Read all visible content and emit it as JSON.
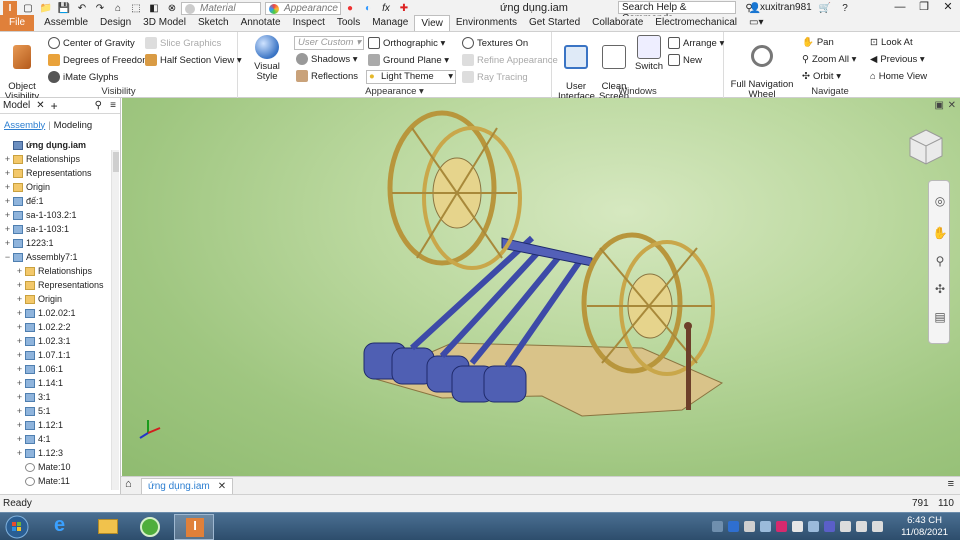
{
  "titlebar": {
    "app_letter": "I",
    "material": "Material",
    "appearance": "Appearance",
    "doc_title": "ứng dụng.iam",
    "search": "Search Help & Commands...",
    "user": "xuxitran981"
  },
  "tabs": [
    "File",
    "Assemble",
    "Design",
    "3D Model",
    "Sketch",
    "Annotate",
    "Inspect",
    "Tools",
    "Manage",
    "View",
    "Environments",
    "Get Started",
    "Collaborate",
    "Electromechanical"
  ],
  "ribbon": {
    "visibility": {
      "object_visibility": "Object\nVisibility",
      "center_of_gravity": "Center of Gravity",
      "degrees_of_freedom": "Degrees of Freedom",
      "imate_glyphs": "iMate Glyphs",
      "slice_graphics": "Slice Graphics",
      "half_section_view": "Half Section View",
      "label": "Visibility"
    },
    "appearance": {
      "visual_style": "Visual Style",
      "user_custom": "User Custom",
      "shadows": "Shadows",
      "reflections": "Reflections",
      "orthographic": "Orthographic",
      "ground_plane": "Ground Plane",
      "light_theme": "Light Theme",
      "textures_on": "Textures On",
      "refine_appearance": "Refine Appearance",
      "ray_tracing": "Ray Tracing",
      "label": "Appearance"
    },
    "windows": {
      "user_interface": "User\nInterface",
      "clean_screen": "Clean\nScreen",
      "switch": "Switch",
      "arrange": "Arrange",
      "new": "New",
      "label": "Windows"
    },
    "navigate": {
      "full_navigation_wheel": "Full Navigation\nWheel",
      "pan": "Pan",
      "zoom_all": "Zoom All",
      "orbit": "Orbit",
      "look_at": "Look At",
      "previous": "Previous",
      "home_view": "Home View",
      "label": "Navigate"
    }
  },
  "browser": {
    "title": "Model",
    "subtab_assembly": "Assembly",
    "subtab_modeling": "Modeling",
    "tree": [
      {
        "label": "ứng dụng.iam",
        "icon": "root",
        "exp": "",
        "indent": 0,
        "bold": true
      },
      {
        "label": "Relationships",
        "icon": "folder",
        "exp": "+",
        "indent": 0
      },
      {
        "label": "Representations",
        "icon": "folder",
        "exp": "+",
        "indent": 0
      },
      {
        "label": "Origin",
        "icon": "folder",
        "exp": "+",
        "indent": 0
      },
      {
        "label": "đế:1",
        "icon": "part",
        "exp": "+",
        "indent": 0
      },
      {
        "label": "sa-1-103.2:1",
        "icon": "part",
        "exp": "+",
        "indent": 0
      },
      {
        "label": "sa-1-103:1",
        "icon": "part",
        "exp": "+",
        "indent": 0
      },
      {
        "label": "1223:1",
        "icon": "part",
        "exp": "+",
        "indent": 0
      },
      {
        "label": "Assembly7:1",
        "icon": "part",
        "exp": "−",
        "indent": 0
      },
      {
        "label": "Relationships",
        "icon": "folder",
        "exp": "+",
        "indent": 1
      },
      {
        "label": "Representations",
        "icon": "folder",
        "exp": "+",
        "indent": 1
      },
      {
        "label": "Origin",
        "icon": "folder",
        "exp": "+",
        "indent": 1
      },
      {
        "label": "1.02.02:1",
        "icon": "part",
        "exp": "+",
        "indent": 1
      },
      {
        "label": "1.02.2:2",
        "icon": "part",
        "exp": "+",
        "indent": 1
      },
      {
        "label": "1.02.3:1",
        "icon": "part",
        "exp": "+",
        "indent": 1
      },
      {
        "label": "1.07.1:1",
        "icon": "part",
        "exp": "+",
        "indent": 1
      },
      {
        "label": "1.06:1",
        "icon": "part",
        "exp": "+",
        "indent": 1
      },
      {
        "label": "1.14:1",
        "icon": "part",
        "exp": "+",
        "indent": 1
      },
      {
        "label": "3:1",
        "icon": "part",
        "exp": "+",
        "indent": 1
      },
      {
        "label": "5:1",
        "icon": "part",
        "exp": "+",
        "indent": 1
      },
      {
        "label": "1.12:1",
        "icon": "part",
        "exp": "+",
        "indent": 1
      },
      {
        "label": "4:1",
        "icon": "part",
        "exp": "+",
        "indent": 1
      },
      {
        "label": "1.12:3",
        "icon": "part",
        "exp": "+",
        "indent": 1
      },
      {
        "label": "Mate:10",
        "icon": "mate",
        "exp": "",
        "indent": 1
      },
      {
        "label": "Mate:11",
        "icon": "mate",
        "exp": "",
        "indent": 1
      }
    ]
  },
  "doc_tab": "ứng dụng.iam",
  "status": {
    "text": "Ready",
    "num1": "791",
    "num2": "110"
  },
  "taskbar": {
    "time": "6:43 CH",
    "date": "11/08/2021"
  },
  "colors": {
    "file_tab": "#e0803a",
    "accent": "#2d7fd1",
    "viewport": "#b4d596"
  }
}
